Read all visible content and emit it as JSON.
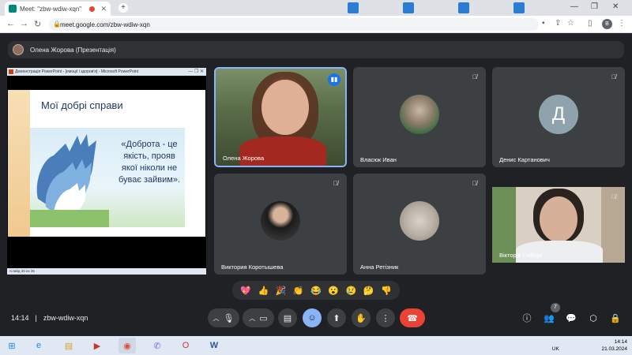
{
  "browser": {
    "tabs": [
      {
        "label": "Meet: \"zbw-wdiw-xqn\"",
        "active": true
      },
      {
        "label": "",
        "active": false
      },
      {
        "label": "",
        "active": false
      },
      {
        "label": "",
        "active": false
      },
      {
        "label": "",
        "active": false
      },
      {
        "label": "",
        "active": false
      }
    ],
    "url": "meet.google.com/zbw-wdiw-xqn",
    "profile_initial": "B"
  },
  "presenter_bar": {
    "label": "Олена Жорова (Презентація)"
  },
  "presentation": {
    "window_title": "Демонстрація PowerPoint - [емоції і здоров'я] - Microsoft PowerPoint",
    "slide_title": "Мої добрі справи",
    "slide_quote": "«Доброта - це якість, прояв якої ніколи не буває зайвим».",
    "status_text": "Слайд 30 из 35"
  },
  "participants": [
    {
      "name": "Олена Жорова",
      "speaking": true,
      "initial": ""
    },
    {
      "name": "Власюк Иван",
      "muted": true,
      "initial": ""
    },
    {
      "name": "Денис Картанович",
      "muted": true,
      "initial": "Д"
    },
    {
      "name": "Виктория Коротышева",
      "muted": true,
      "initial": ""
    },
    {
      "name": "Анна Ретізник",
      "muted": true,
      "initial": ""
    },
    {
      "name": "Вікторія Глібчук",
      "muted": true,
      "initial": ""
    }
  ],
  "reactions": [
    "💖",
    "👍",
    "🎉",
    "👏",
    "😂",
    "😮",
    "😢",
    "🤔",
    "👎"
  ],
  "meeting": {
    "time": "14:14",
    "separator": "|",
    "code": "zbw-wdiw-xqn",
    "participant_count": "7"
  },
  "taskbar": {
    "language": "UK",
    "time": "14:14",
    "date": "21.03.2024"
  },
  "colors": {
    "background": "#202124",
    "tile": "#3c4043",
    "leave": "#ea4335",
    "accent_active": "#8ab4f8"
  }
}
